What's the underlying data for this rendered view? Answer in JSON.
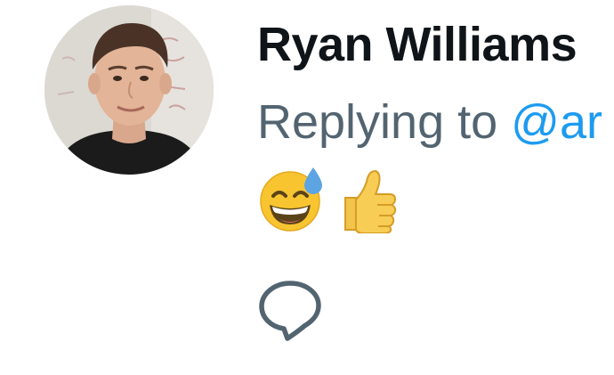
{
  "tweet": {
    "author_name": "Ryan Williams",
    "replying_prefix": "Replying to ",
    "replying_mention": "@ar",
    "avatar_icon": "person-avatar",
    "emojis": [
      {
        "name": "grinning-face-with-sweat",
        "glyph": "😅"
      },
      {
        "name": "thumbs-up",
        "glyph": "👍"
      }
    ],
    "actions": {
      "reply_icon": "speech-bubble-icon"
    },
    "colors": {
      "name_text": "#0f1419",
      "secondary_text": "#536471",
      "link": "#1d9bf0",
      "icon": "#536471"
    }
  }
}
